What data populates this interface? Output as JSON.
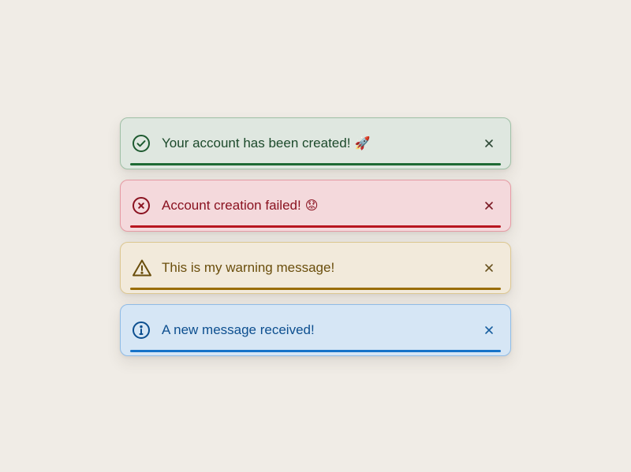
{
  "toasts": [
    {
      "type": "success",
      "message": "Your account has been created!",
      "emoji": "🚀",
      "icon": "check-circle-icon",
      "accent": "#1e6a34"
    },
    {
      "type": "error",
      "message": "Account creation failed!",
      "emoji": "😟",
      "icon": "x-circle-icon",
      "accent": "#b8161f"
    },
    {
      "type": "warning",
      "message": "This is my warning message!",
      "emoji": "",
      "icon": "warning-triangle-icon",
      "accent": "#9a6d05"
    },
    {
      "type": "info",
      "message": "A new message received!",
      "emoji": "",
      "icon": "info-circle-icon",
      "accent": "#1673c8"
    }
  ]
}
